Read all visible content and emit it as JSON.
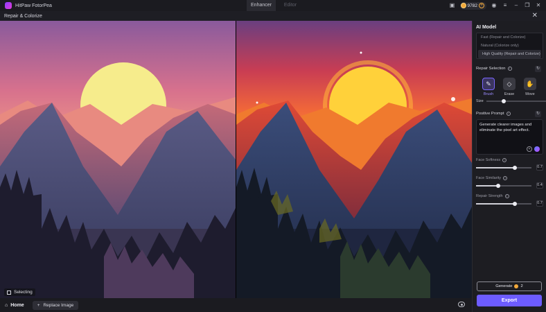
{
  "app": {
    "name": "HitPaw FotorPea"
  },
  "tabs": [
    {
      "label": "Enhancer"
    },
    {
      "label": "Editor"
    }
  ],
  "titlebar": {
    "coins": "9782"
  },
  "subbar": {
    "title": "Repair & Colorize"
  },
  "canvas": {
    "selecting_label": "Selecting"
  },
  "bottombar": {
    "home_label": "Home",
    "replace_label": "Replace Image"
  },
  "panel": {
    "ai_model_title": "AI Model",
    "models": [
      {
        "label": "Fast (Repair and Colorize)"
      },
      {
        "label": "Natural (Colorize only)"
      },
      {
        "label": "High Quality (Repair and Colorize)"
      }
    ],
    "repair_selection_label": "Repair Selection",
    "tools": [
      {
        "label": "Brush"
      },
      {
        "label": "Erase"
      },
      {
        "label": "Move"
      }
    ],
    "size_label": "Size",
    "positive_prompt_label": "Positive Prompt",
    "prompt_text": "Generate clearer images and eliminate the pixel art effect.",
    "sliders": [
      {
        "label": "Face Softness",
        "value": "0.7",
        "fraction": 0.7
      },
      {
        "label": "Face Similarity",
        "value": "0.4",
        "fraction": 0.4
      },
      {
        "label": "Repair Strength",
        "value": "0.7",
        "fraction": 0.7
      }
    ],
    "generate_label": "Generate",
    "generate_cost": "2",
    "export_label": "Export"
  },
  "colors": {
    "accent": "#6d5cff",
    "coin": "#f2a93b"
  }
}
